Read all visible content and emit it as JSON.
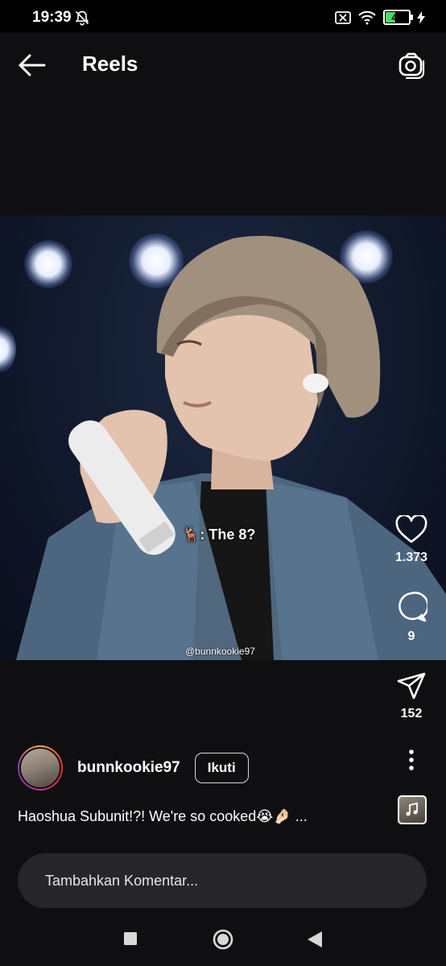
{
  "status": {
    "time": "19:39",
    "battery": "47"
  },
  "header": {
    "title": "Reels"
  },
  "video": {
    "caption": ": The 8?",
    "caption_emoji": "🦌",
    "watermark": "@bunnkookie97"
  },
  "actions": {
    "likes": "1.373",
    "comments": "9",
    "shares": "152"
  },
  "author": {
    "username": "bunnkookie97",
    "follow_label": "Ikuti"
  },
  "description": "Haoshua Subunit!?! We're so cooked😭🤌🏻 ...",
  "comment": {
    "placeholder": "Tambahkan Komentar..."
  },
  "icons": [
    "back-arrow-icon",
    "camera-icon",
    "heart-icon",
    "comment-icon",
    "share-icon",
    "more-icon",
    "music-icon",
    "muted-bell-icon",
    "wifi-icon",
    "sim-icon",
    "battery-icon",
    "charging-icon"
  ],
  "colors": {
    "background": "#0f0f11",
    "comment_box": "#26262a",
    "battery_fill": "#4cd964"
  }
}
